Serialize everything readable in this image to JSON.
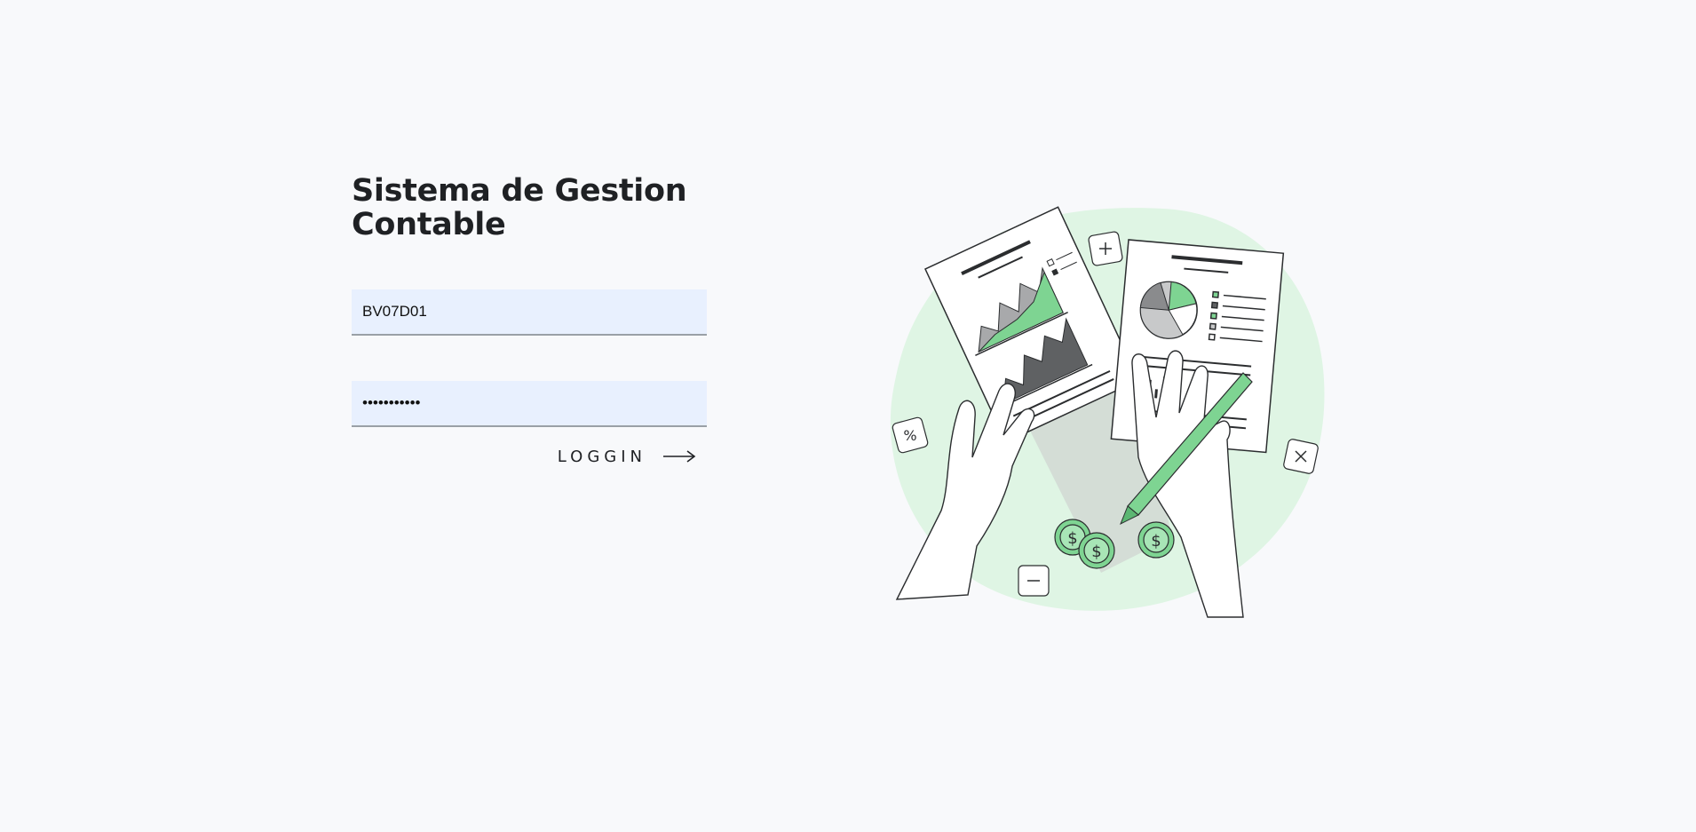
{
  "app": {
    "title": "Sistema de Gestion Contable"
  },
  "login_form": {
    "username_value": "BV07D01",
    "password_value": "•••••••••••",
    "login_label": "LOGGIN"
  },
  "illustration": {
    "icon": "accounting-documents-illustration",
    "accent_color": "#7ed492",
    "blob_color": "#dff5e4"
  },
  "colors": {
    "background": "#f8f9fb",
    "input_fill": "#e8f0fe",
    "text": "#1f2124"
  }
}
